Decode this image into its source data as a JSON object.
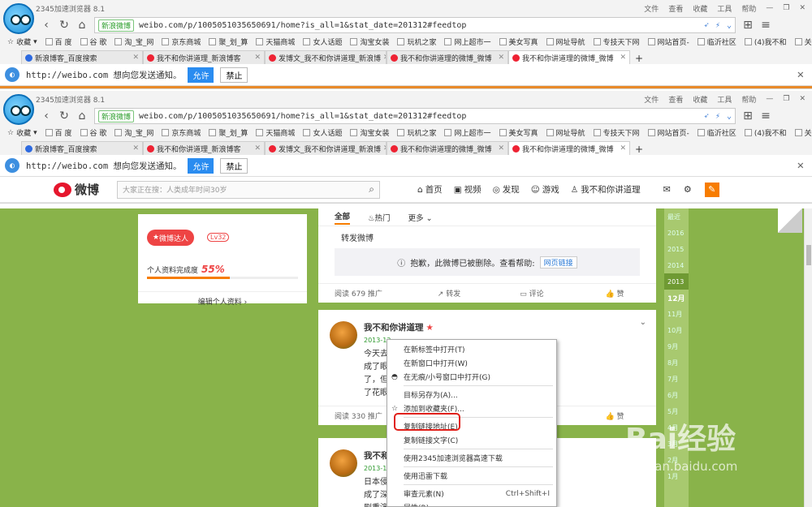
{
  "browser": {
    "title": "2345加速浏览器 8.1",
    "menu": [
      "文件",
      "查看",
      "收藏",
      "工具",
      "帮助"
    ],
    "secure_label": "新浪微博",
    "url": "weibo.com/p/1005051035650691/home?is_all=1&stat_date=201312#feedtop",
    "bookmarks": [
      "收藏",
      "百 度",
      "谷 歌",
      "淘_宝_网",
      "京东商城",
      "聚_划_算",
      "天猫商城",
      "女人话题",
      "淘宝女装",
      "玩机之家",
      "网上超市一",
      "美女写真",
      "网址导航",
      "专技天下网",
      "网站首页-",
      "临沂社区",
      "(4)我不和",
      "关于申报基"
    ],
    "tabs": [
      "新浪博客_百度搜索",
      "我不和你讲道理_新浪博客",
      "发博文_我不和你讲道理_新浪博",
      "我不和你讲道理的微博_微博",
      "我不和你讲道理的微博_微博"
    ],
    "notify_text": "http://weibo.com 想向您发送通知。",
    "allow": "允许",
    "deny": "禁止"
  },
  "weibo": {
    "brand": "微博",
    "search_placeholder": "大家正在搜：人类成年时间30岁",
    "nav": [
      "首页",
      "视频",
      "发现",
      "游戏",
      "我不和你讲道理"
    ]
  },
  "profile": {
    "badge": "微博达人",
    "level": "Lv32",
    "completion_label": "个人资料完成度",
    "completion": "55%",
    "completion_fraction": 0.55,
    "edit": "编辑个人资料 ›"
  },
  "feed1": {
    "tabs": [
      "全部",
      "热门",
      "更多"
    ],
    "repost": "转发微博",
    "deleted": "抱歉，此微博已被删除。查看帮助:",
    "deleted_link": "网页链接",
    "actions": [
      "阅读 679  推广",
      "转发",
      "评论",
      "赞"
    ]
  },
  "feed2": {
    "user": "我不和你讲道理",
    "date": "2013-12",
    "text": "今天去　　　　　　　　　　　　　　　　　　　　　　　　　　　　　　　成了眼病博物馆了。既有近视　　　　　　　　　　　　　　　　　　　　　　　　　　　了，但看不远，不带眼镜看得　　　　　　　　　　　　　　　　　　　　　　　　　　　了花眼和近视会互相抵销视力",
    "actions": [
      "阅读 330  推广",
      "",
      "",
      "赞"
    ]
  },
  "feed3": {
    "user": "我不和",
    "date": "2013-1",
    "text": "日本侵　　　　　　　　　　　　　　　　　　　　　　　　　　　　　　　成了深重灾难，这对包括战犯　　　　　　　　　　　　　　　　　　　　　　　　　　　　剧重演，关键是增强我们自身　　　　　　　　　　　　　　　　　　　　　　　　　　　　的本质和灾难，单靠想"
  },
  "timeline": [
    "最近",
    "2016",
    "2015",
    "2014",
    "2013",
    "12月",
    "11月",
    "10月",
    "9月",
    "8月",
    "7月",
    "6月",
    "5月",
    "4月",
    "3月",
    "2月",
    "1月"
  ],
  "context_menu": {
    "items": [
      "在新标签中打开(T)",
      "在新窗口中打开(W)",
      "在无痕/小号窗口中打开(G)",
      "目标另存为(A)...",
      "添加到收藏夹(F)...",
      "复制链接地址(E)",
      "复制链接文字(C)",
      "使用2345加速浏览器高速下载",
      "使用迅雷下载",
      "审查元素(N)",
      "属性(R)"
    ],
    "shortcut": "Ctrl+Shift+I"
  },
  "watermark": {
    "brand": "Bai经验",
    "url": "jingyan.baidu.com"
  }
}
